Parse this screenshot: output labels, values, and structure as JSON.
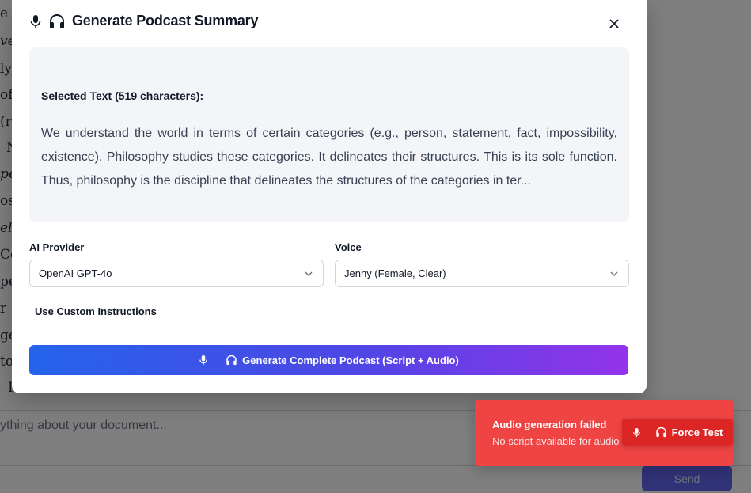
{
  "background": {
    "doc_fragments": [
      "e",
      "ve",
      "ly",
      "of",
      "(r",
      "N",
      "pe",
      "os",
      "eli",
      "Co",
      "pe",
      "r",
      "ge",
      "to",
      "I"
    ],
    "input_placeholder": "ything about your document...",
    "send_label": "Send"
  },
  "modal": {
    "title": "Generate Podcast Summary",
    "icons": [
      "microphone-icon",
      "headphones-icon"
    ],
    "close_label": "×",
    "selected_text_label": "Selected Text (519 characters):",
    "selected_text": "We understand the world in terms of certain categories (e.g., person, statement, fact, impossibility, existence). Philosophy studies these categories. It delineates their structures. This is its sole function. Thus, philosophy is the discipline that delineates the structures of the categories in ter...",
    "ai_provider": {
      "label": "AI Provider",
      "value": "OpenAI GPT-4o"
    },
    "voice": {
      "label": "Voice",
      "value": "Jenny (Female, Clear)"
    },
    "custom_instructions_label": "Use Custom Instructions",
    "generate_button_label": "Generate Complete Podcast (Script + Audio)"
  },
  "toast": {
    "title": "Audio generation failed",
    "message": "No script available for audio",
    "force_test_label": "Force Test"
  },
  "colors": {
    "toast_bg": "#ef4444",
    "gradient_start": "#2563eb",
    "gradient_end": "#9333ea",
    "send_bg": "#6366f1"
  }
}
